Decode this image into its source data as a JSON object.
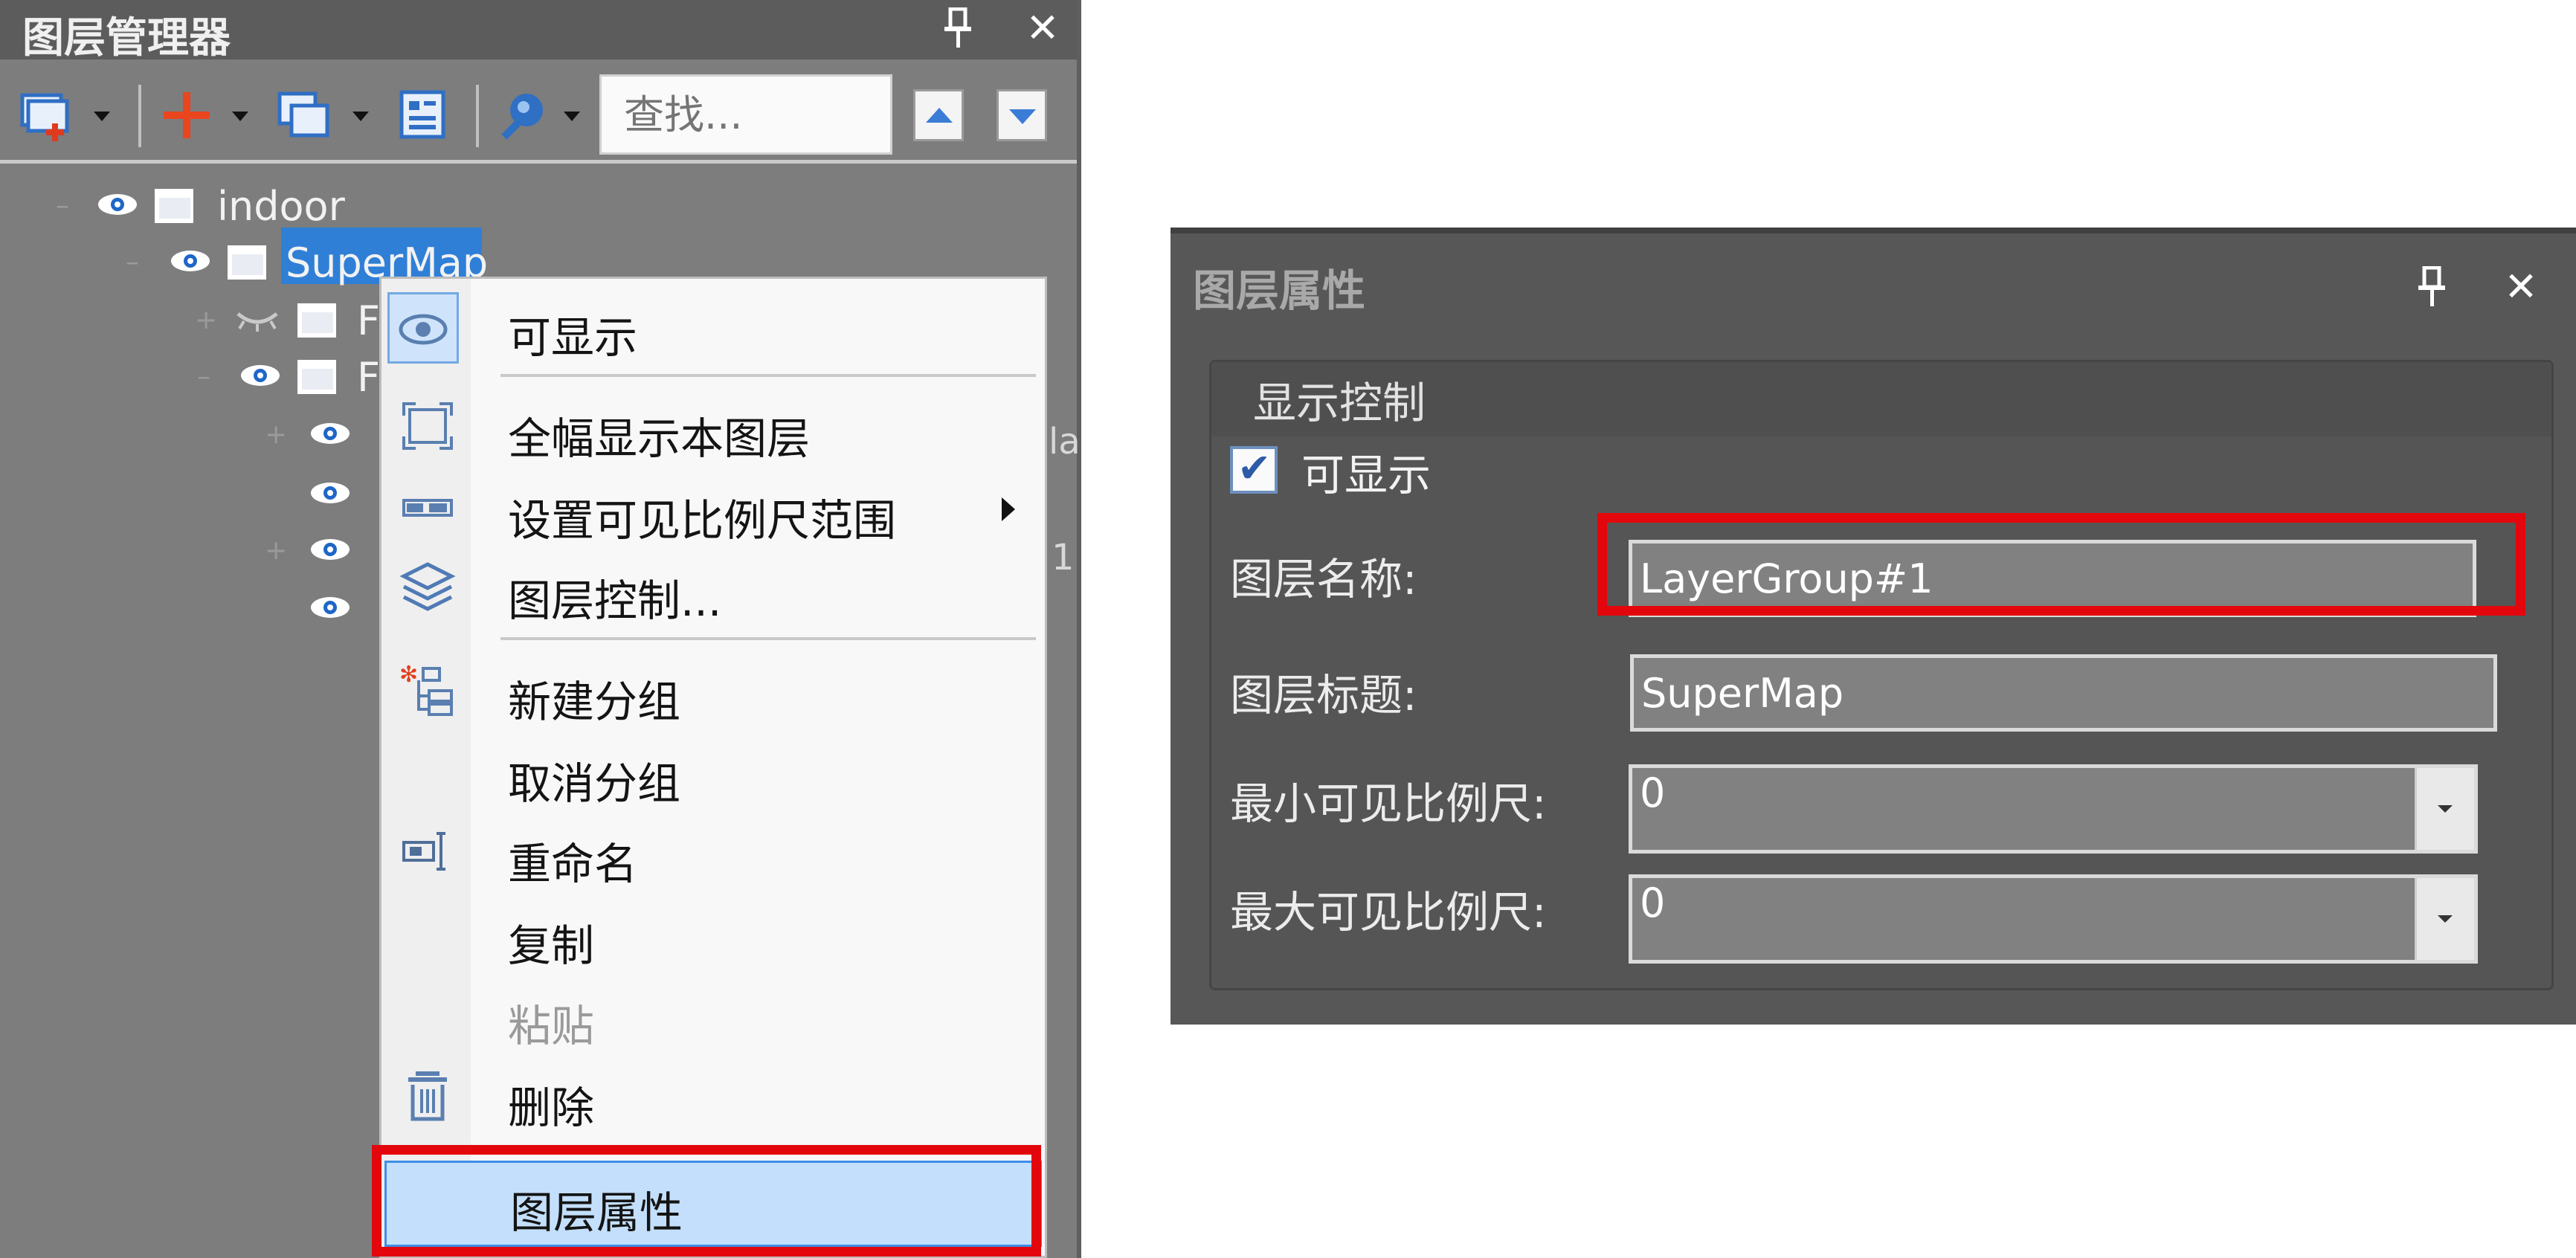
{
  "layer_manager": {
    "title": "图层管理器",
    "pin_glyph": "⪵",
    "close_glyph": "✕",
    "search_placeholder": "查找...",
    "tree": {
      "root": "indoor",
      "selected": "SuperMap",
      "partial_child_1": "F",
      "partial_child_2": "F",
      "right_clip_1": "la",
      "right_clip_2": "1"
    },
    "icons": {
      "add_layer": "new-layer-icon",
      "add": "plus-icon",
      "copy": "copy-layers-icon",
      "properties": "layer-props-icon",
      "search": "magnifier-icon"
    }
  },
  "context_menu": {
    "items": [
      {
        "label": "可显示",
        "icon": "eye-icon"
      },
      {
        "label": "全幅显示本图层",
        "icon": "full-extent-icon"
      },
      {
        "label": "设置可见比例尺范围",
        "icon": "scale-range-icon"
      },
      {
        "label": "图层控制...",
        "icon": "layers-stack-icon"
      },
      {
        "label": "新建分组",
        "icon": "new-group-icon"
      },
      {
        "label": "取消分组",
        "icon": ""
      },
      {
        "label": "重命名",
        "icon": "rename-icon"
      },
      {
        "label": "复制",
        "icon": ""
      },
      {
        "label": "粘贴",
        "icon": ""
      },
      {
        "label": "删除",
        "icon": "trash-icon"
      },
      {
        "label": "图层属性",
        "icon": ""
      }
    ],
    "highlight_color": "#c3dffb"
  },
  "layer_properties": {
    "title": "图层属性",
    "group_title": "显示控制",
    "visible_label": "可显示",
    "visible_checked": true,
    "check_glyph": "✔",
    "name_label": "图层名称:",
    "name_value": "LayerGroup#1",
    "caption_label": "图层标题:",
    "caption_value": "SuperMap",
    "min_scale_label": "最小可见比例尺:",
    "min_scale_value": "0",
    "max_scale_label": "最大可见比例尺:",
    "max_scale_value": "0"
  },
  "colors": {
    "highlight_red": "#e3060d",
    "selection_blue": "#2f7fd7",
    "panel_dark": "#575757"
  }
}
